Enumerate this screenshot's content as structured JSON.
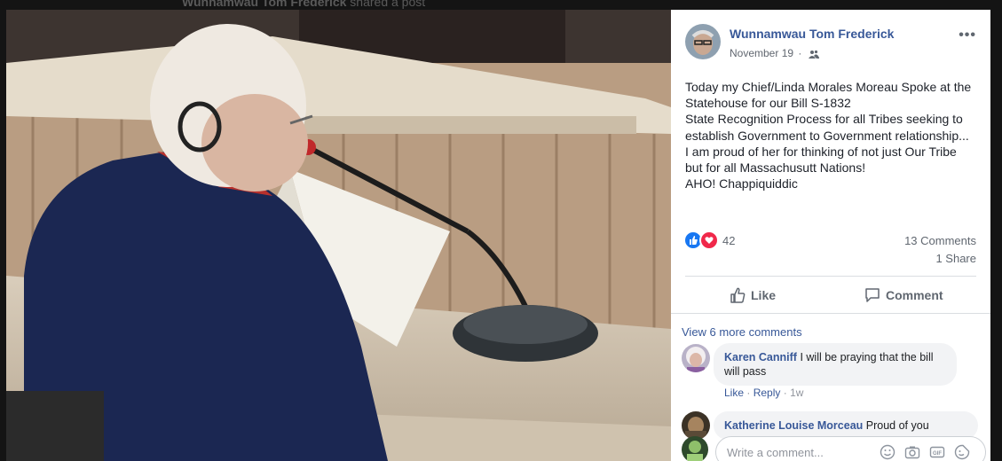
{
  "background_header": {
    "name": "Wunnamwau Tom Frederick",
    "action": "shared a post"
  },
  "post": {
    "author": "Wunnamwau Tom Frederick",
    "date": "November 19",
    "date_separator": "·",
    "audience_icon": "friends-icon",
    "more_label": "•••",
    "text_lines": [
      "Today my Chief/Linda Morales Moreau Spoke at the",
      "Statehouse for our Bill S-1832",
      "State Recognition Process for all Tribes seeking to",
      "establish Government to Government relationship...",
      "I am proud of her for thinking of not just Our Tribe",
      "but for all Massachusutt Nations!",
      "AHO! Chappiquiddic"
    ],
    "reactions": {
      "icons": [
        "like-icon",
        "love-icon"
      ],
      "count": "42",
      "like_color": "#1877f2",
      "love_color": "#f0284a"
    },
    "comments_count": "13 Comments",
    "shares_count": "1 Share"
  },
  "actions": {
    "like_label": "Like",
    "comment_label": "Comment"
  },
  "comments": {
    "view_more": "View 6 more comments",
    "items": [
      {
        "author": "Karen Canniff",
        "text_line1": "I will be praying that the bill",
        "text_line2": "will pass",
        "like": "Like",
        "reply": "Reply",
        "sep": "·",
        "time": "1w"
      },
      {
        "author": "Katherine Louise Morceau",
        "text": "Proud of you"
      }
    ]
  },
  "composer": {
    "placeholder": "Write a comment...",
    "icons": [
      "emoji-icon",
      "camera-icon",
      "gif-icon",
      "sticker-icon"
    ]
  },
  "colors": {
    "link": "#385898",
    "brand": "#1877f2"
  }
}
